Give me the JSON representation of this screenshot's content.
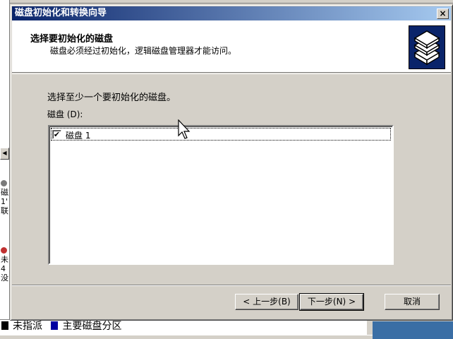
{
  "background": {
    "left_items": [
      "磁",
      "1'",
      "联",
      "未",
      "4",
      "没"
    ],
    "legend": [
      {
        "label": "未指派",
        "color": "#000000"
      },
      {
        "label": "主要磁盘分区",
        "color": "#0000a0"
      }
    ]
  },
  "dialog": {
    "title": "磁盘初始化和转换向导",
    "close_label": "×",
    "header": {
      "title": "选择要初始化的磁盘",
      "subtitle": "磁盘必须经过初始化，逻辑磁盘管理器才能访问。",
      "icon": "disks-icon"
    },
    "instruction": "选择至少一个要初始化的磁盘。",
    "list_label": "磁盘 (D):",
    "disks": [
      {
        "label": "磁盘 1",
        "checked": true
      }
    ],
    "buttons": {
      "back": "< 上一步(B)",
      "next": "下一步(N) >",
      "cancel": "取消"
    }
  },
  "colors": {
    "title_gradient_start": "#0a246a",
    "title_gradient_end": "#a6caf0",
    "face": "#d4d0c8",
    "desktop": "#3a6ea5"
  }
}
